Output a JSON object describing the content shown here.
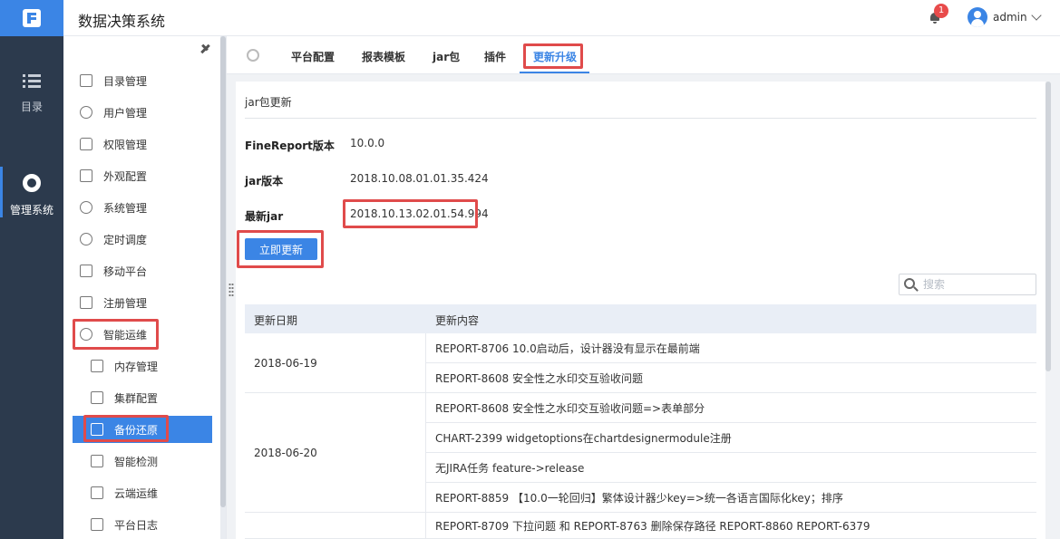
{
  "app": {
    "title": "数据决策系统"
  },
  "rail": {
    "catalog_label": "目录",
    "admin_label": "管理系统"
  },
  "header": {
    "notification_count": "1",
    "user_name": "admin"
  },
  "sidebar": {
    "items": [
      {
        "label": "目录管理",
        "icon": "list-icon"
      },
      {
        "label": "用户管理",
        "icon": "user-icon"
      },
      {
        "label": "权限管理",
        "icon": "lock-icon"
      },
      {
        "label": "外观配置",
        "icon": "paint-roller-icon"
      },
      {
        "label": "系统管理",
        "icon": "gear-icon"
      },
      {
        "label": "定时调度",
        "icon": "timer-icon"
      },
      {
        "label": "移动平台",
        "icon": "mobile-icon"
      },
      {
        "label": "注册管理",
        "icon": "register-icon"
      },
      {
        "label": "智能运维",
        "icon": "network-icon"
      }
    ],
    "sub_items": [
      {
        "label": "内存管理",
        "icon": "memory-icon"
      },
      {
        "label": "集群配置",
        "icon": "server-icon"
      },
      {
        "label": "备份还原",
        "icon": "backup-icon"
      },
      {
        "label": "智能检测",
        "icon": "monitor-icon"
      },
      {
        "label": "云端运维",
        "icon": "cloud-monitor-icon"
      },
      {
        "label": "平台日志",
        "icon": "log-icon"
      }
    ]
  },
  "tabs": [
    {
      "label": "平台配置"
    },
    {
      "label": "报表模板"
    },
    {
      "label": "jar包"
    },
    {
      "label": "插件"
    },
    {
      "label": "更新升级"
    }
  ],
  "main": {
    "section_title": "jar包更新",
    "fr_version_label": "FineReport版本",
    "fr_version_value": "10.0.0",
    "jar_version_label": "jar版本",
    "jar_version_value": "2018.10.08.01.01.35.424",
    "latest_jar_label": "最新jar",
    "latest_jar_value": "2018.10.13.02.01.54.994",
    "update_button": "立即更新",
    "search_placeholder": "搜索"
  },
  "table": {
    "headers": [
      "更新日期",
      "更新内容"
    ],
    "groups": [
      {
        "date": "2018-06-19",
        "rows": [
          "REPORT-8706 10.0启动后，设计器没有显示在最前端",
          "REPORT-8608 安全性之水印交互验收问题"
        ]
      },
      {
        "date": "2018-06-20",
        "rows": [
          "REPORT-8608 安全性之水印交互验收问题=>表单部分",
          "CHART-2399  widgetoptions在chartdesignermodule注册",
          "无JIRA任务 feature->release",
          "REPORT-8859 【10.0一轮回归】繁体设计器少key=>统一各语言国际化key；排序"
        ]
      },
      {
        "date": "",
        "rows": [
          "REPORT-8709 下拉问题 和 REPORT-8763 删除保存路径 REPORT-8860  REPORT-6379"
        ]
      }
    ]
  }
}
